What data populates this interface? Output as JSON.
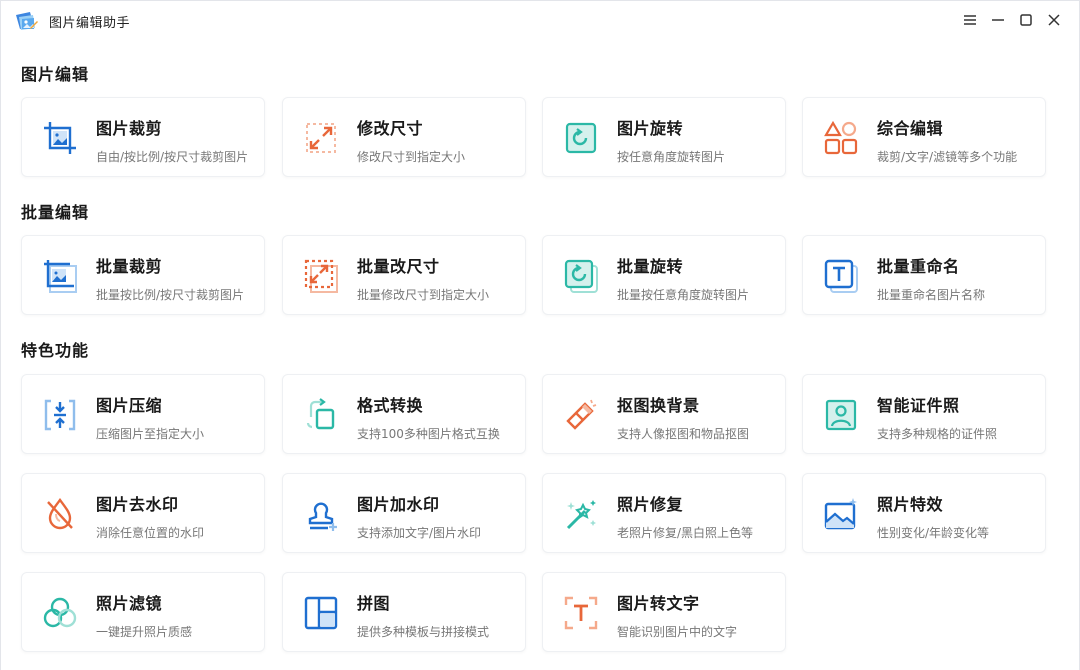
{
  "app": {
    "title": "图片编辑助手"
  },
  "colors": {
    "blue": "#1f6fd0",
    "orange": "#e8673a",
    "teal": "#2bb8a6",
    "red": "#e0533a"
  },
  "sections": [
    {
      "title": "图片编辑",
      "cards": [
        {
          "name": "图片裁剪",
          "desc": "自由/按比例/按尺寸裁剪图片",
          "icon": "crop-icon"
        },
        {
          "name": "修改尺寸",
          "desc": "修改尺寸到指定大小",
          "icon": "resize-icon"
        },
        {
          "name": "图片旋转",
          "desc": "按任意角度旋转图片",
          "icon": "rotate-icon"
        },
        {
          "name": "综合编辑",
          "desc": "裁剪/文字/滤镜等多个功能",
          "icon": "shapes-icon"
        }
      ]
    },
    {
      "title": "批量编辑",
      "cards": [
        {
          "name": "批量裁剪",
          "desc": "批量按比例/按尺寸裁剪图片",
          "icon": "batch-crop-icon"
        },
        {
          "name": "批量改尺寸",
          "desc": "批量修改尺寸到指定大小",
          "icon": "batch-resize-icon"
        },
        {
          "name": "批量旋转",
          "desc": "批量按任意角度旋转图片",
          "icon": "batch-rotate-icon"
        },
        {
          "name": "批量重命名",
          "desc": "批量重命名图片名称",
          "icon": "batch-rename-icon"
        }
      ]
    },
    {
      "title": "特色功能",
      "cards": [
        {
          "name": "图片压缩",
          "desc": "压缩图片至指定大小",
          "icon": "compress-icon"
        },
        {
          "name": "格式转换",
          "desc": "支持100多种图片格式互换",
          "icon": "format-convert-icon"
        },
        {
          "name": "抠图换背景",
          "desc": "支持人像抠图和物品抠图",
          "icon": "eraser-icon"
        },
        {
          "name": "智能证件照",
          "desc": "支持多种规格的证件照",
          "icon": "id-photo-icon"
        },
        {
          "name": "图片去水印",
          "desc": "消除任意位置的水印",
          "icon": "remove-watermark-icon"
        },
        {
          "name": "图片加水印",
          "desc": "支持添加文字/图片水印",
          "icon": "stamp-icon"
        },
        {
          "name": "照片修复",
          "desc": "老照片修复/黑白照上色等",
          "icon": "magic-wand-icon"
        },
        {
          "name": "照片特效",
          "desc": "性别变化/年龄变化等",
          "icon": "photo-effect-icon"
        },
        {
          "name": "照片滤镜",
          "desc": "一键提升照片质感",
          "icon": "filter-icon"
        },
        {
          "name": "拼图",
          "desc": "提供多种模板与拼接模式",
          "icon": "collage-icon"
        },
        {
          "name": "图片转文字",
          "desc": "智能识别图片中的文字",
          "icon": "ocr-icon"
        }
      ]
    }
  ]
}
